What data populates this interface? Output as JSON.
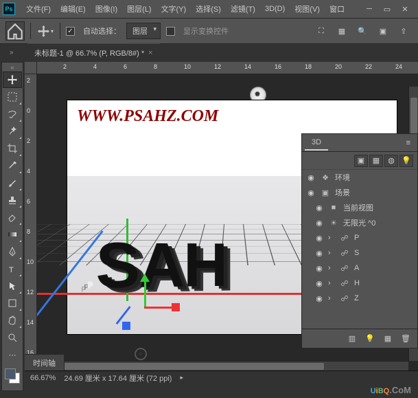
{
  "menubar": {
    "logo": "Ps",
    "items": [
      "文件(F)",
      "编辑(E)",
      "图像(I)",
      "图层(L)",
      "文字(Y)",
      "选择(S)",
      "滤镜(T)",
      "3D(D)",
      "视图(V)",
      "窗口"
    ]
  },
  "optbar": {
    "auto_select_label": "自动选择：",
    "layer_drop": "图层",
    "transform_label": "显示变换控件"
  },
  "doc_tab": {
    "title": "未标题-1 @ 66.7% (P, RGB/8#) *"
  },
  "ruler_h": [
    "2",
    "4",
    "6",
    "8",
    "10",
    "12",
    "14",
    "16",
    "18",
    "20",
    "22",
    "24"
  ],
  "ruler_v": [
    "2",
    "0",
    "2",
    "4",
    "6",
    "8",
    "10",
    "12",
    "14",
    "16"
  ],
  "canvas": {
    "watermark": "WWW.PSAHZ.COM",
    "text3d": "PSAH"
  },
  "panel3d": {
    "tab": "3D",
    "rows": [
      {
        "depth": 0,
        "eye": "◉",
        "icon": "❖",
        "label": "环境"
      },
      {
        "depth": 0,
        "eye": "◉",
        "icon": "▣",
        "label": "场景"
      },
      {
        "depth": 1,
        "eye": "◉",
        "icon": "■",
        "label": "当前视图"
      },
      {
        "depth": 1,
        "eye": "◉",
        "icon": "☀",
        "label": "无限光 ^0"
      },
      {
        "depth": 1,
        "eye": "◉",
        "icon": "☍",
        "label": "P"
      },
      {
        "depth": 1,
        "eye": "◉",
        "icon": "☍",
        "label": "S"
      },
      {
        "depth": 1,
        "eye": "◉",
        "icon": "☍",
        "label": "A"
      },
      {
        "depth": 1,
        "eye": "◉",
        "icon": "☍",
        "label": "H"
      },
      {
        "depth": 1,
        "eye": "◉",
        "icon": "☍",
        "label": "Z"
      }
    ]
  },
  "timeline": {
    "tab": "时间轴"
  },
  "status": {
    "zoom": "66.67%",
    "dims": "24.69 厘米 x 17.64 厘米 (72 ppi)"
  },
  "uibq": {
    "u": "U",
    "i": "i",
    "b": "B",
    "q": "Q",
    "com": ".CoM"
  }
}
